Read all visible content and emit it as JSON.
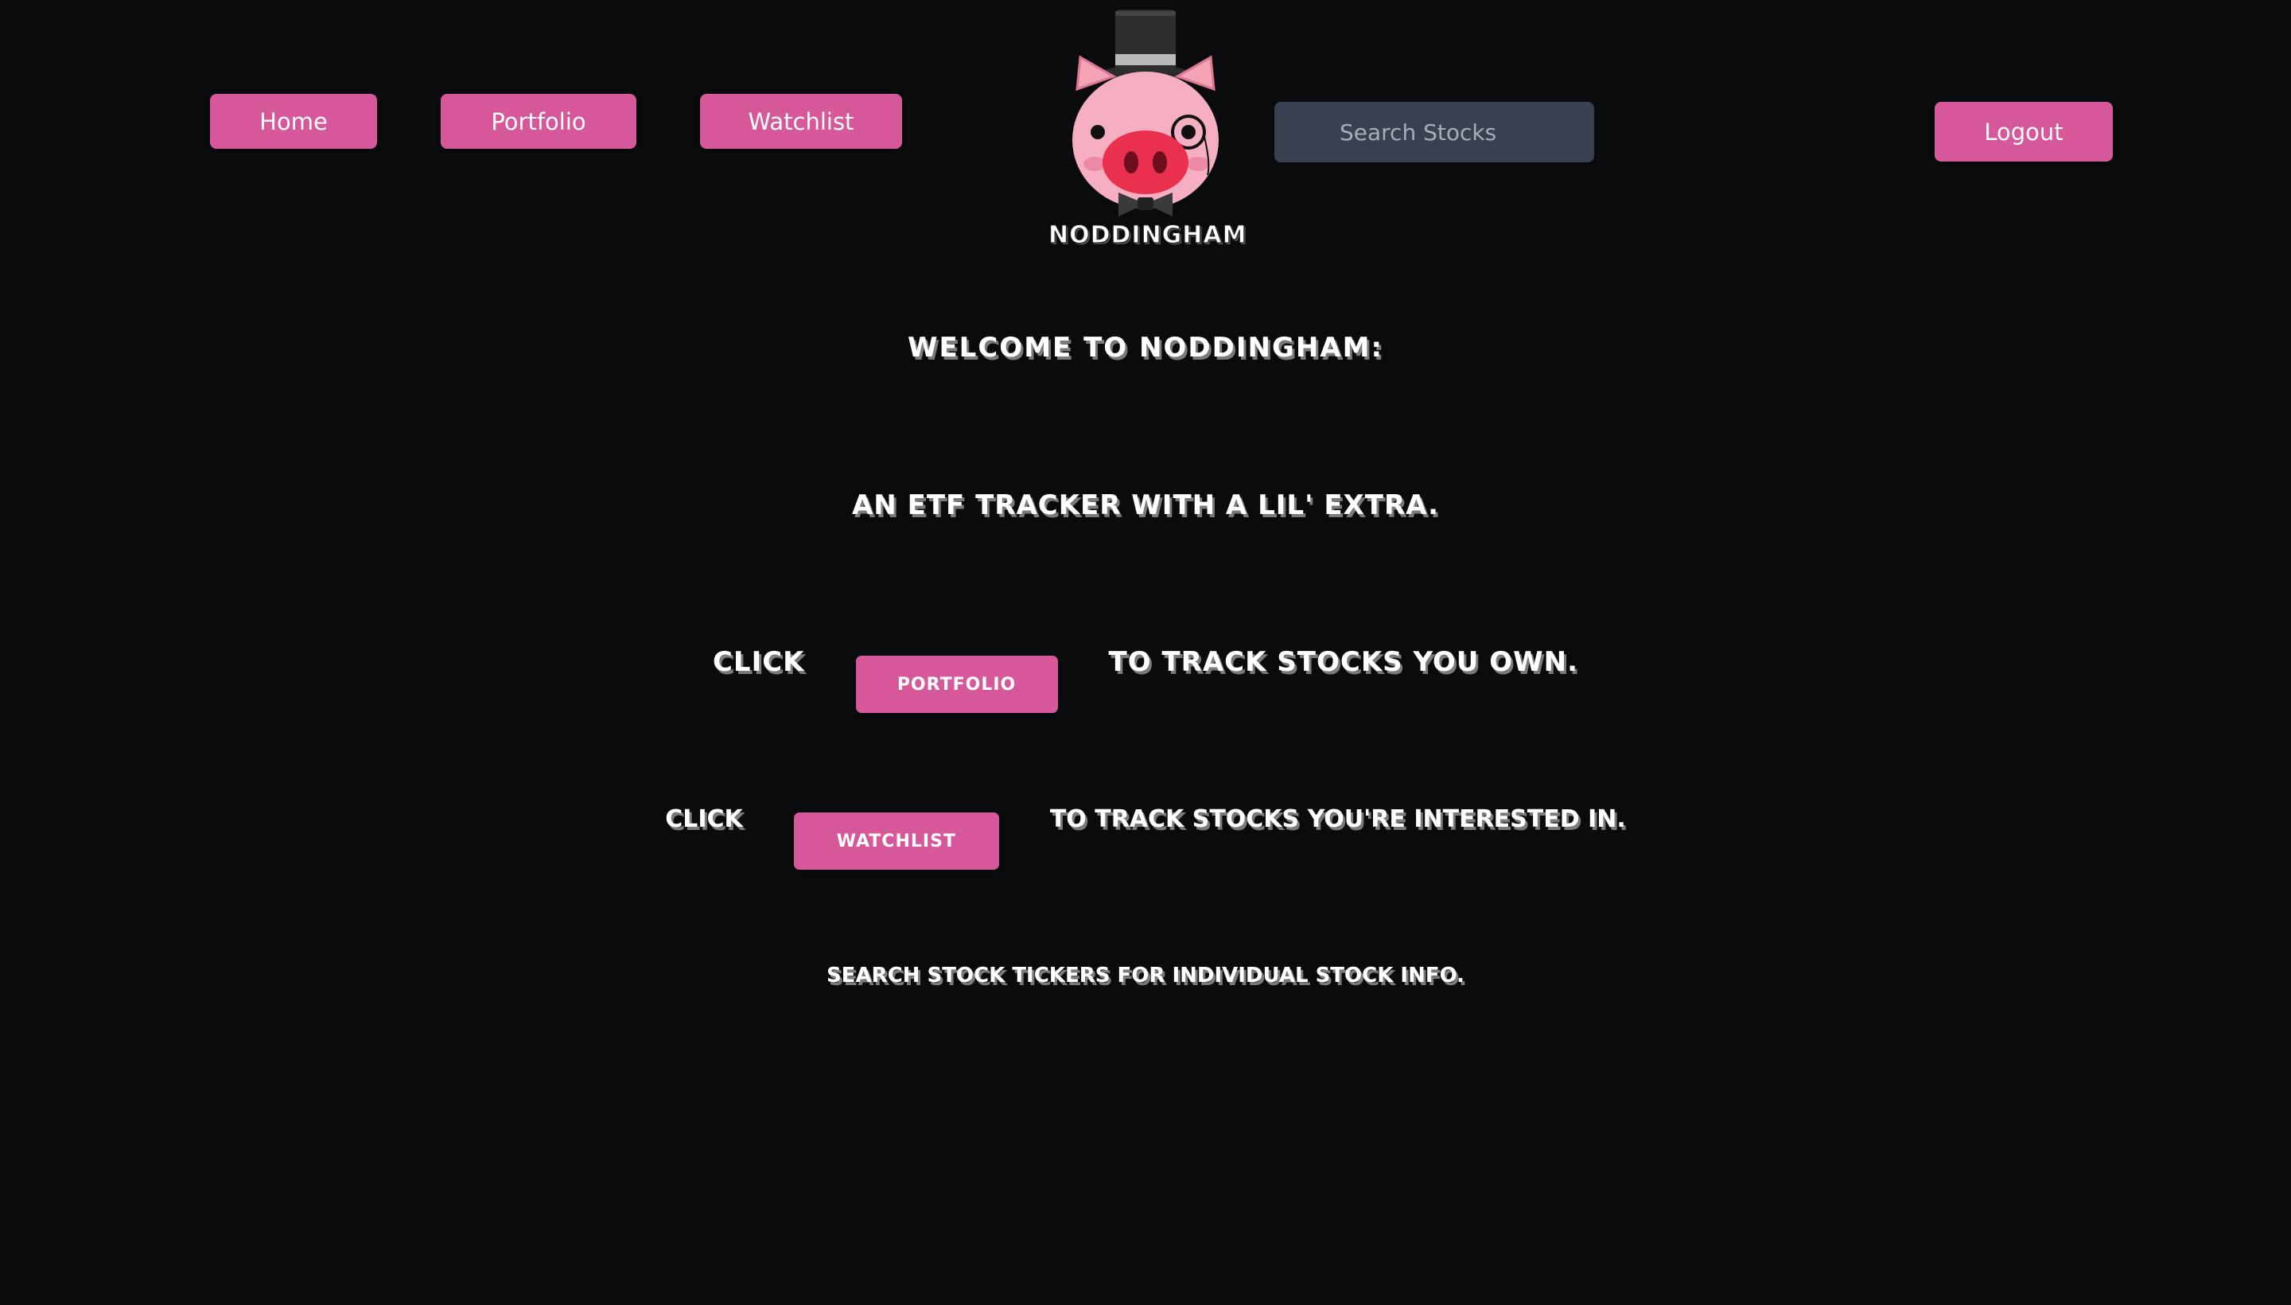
{
  "nav": {
    "home_label": "Home",
    "portfolio_label": "Portfolio",
    "watchlist_label": "Watchlist",
    "logout_label": "Logout"
  },
  "search": {
    "placeholder": "Search Stocks",
    "value": ""
  },
  "logo": {
    "text": "NODDINGHAM",
    "icon": "pig-with-top-hat-and-monocle"
  },
  "main": {
    "line1": "WELCOME TO NODDINGHAM:",
    "line2": "AN ETF TRACKER WITH A LIL' EXTRA.",
    "line3_prefix": "CLICK",
    "line3_button": "PORTFOLIO",
    "line3_suffix": "TO TRACK STOCKS YOU OWN.",
    "line4_prefix": "CLICK",
    "line4_button": "WATCHLIST",
    "line4_suffix": "TO TRACK STOCKS YOU'RE INTERESTED IN.",
    "line5": "SEARCH STOCK TICKERS FOR INDIVIDUAL STOCK INFO."
  },
  "colors": {
    "background": "#0a0b0d",
    "accent": "#d6579a",
    "search_bg": "#394150",
    "text": "#ffffff"
  }
}
